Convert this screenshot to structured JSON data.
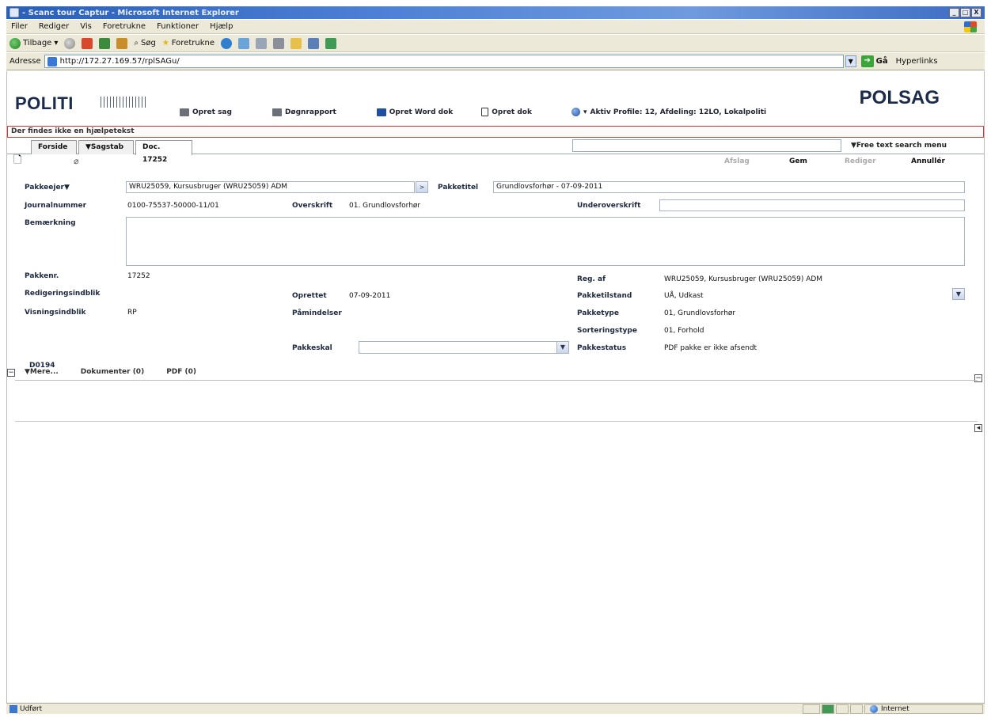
{
  "window": {
    "title": "- Scanc tour Captur - Microsoft Internet Explorer",
    "minimize": "_",
    "maximize": "□",
    "close": "X"
  },
  "menu": [
    "Filer",
    "Rediger",
    "Vis",
    "Foretrukne",
    "Funktioner",
    "Hjælp"
  ],
  "toolbar": {
    "back": "Tilbage",
    "search": "Søg",
    "favorites": "Foretrukne"
  },
  "address": {
    "label": "Adresse",
    "url": "http://172.27.169.57/rplSAGu/",
    "go": "Gå",
    "links": "Hyperlinks"
  },
  "brand": {
    "left": "POLITI",
    "right": "POLSAG"
  },
  "nav": {
    "opret_sag": "Opret sag",
    "dagsrapport": "Døgnrapport",
    "opret_word": "Opret Word dok",
    "opret_dok": "Opret dok",
    "profile": "Aktiv Profile: 12, Afdeling: 12LO, Lokalpoliti"
  },
  "help_text": "Der findes ikke en hjælpetekst",
  "tabs": {
    "forside": "Forside",
    "sagstab": "▼Sagstab",
    "doc": "Doc. 17252",
    "free_text_menu": "▼Free text search menu"
  },
  "actions": {
    "afslag": "Afslag",
    "gem": "Gem",
    "rediger": "Rediger",
    "annuller": "Annullér"
  },
  "form": {
    "pakkeejer_label": "Pakkeejer▼",
    "pakkeejer_value": "WRU25059, Kursusbruger (WRU25059) ADM",
    "pakketitel_label": "Pakketitel",
    "pakketitel_value": "Grundlovsforhør - 07-09-2011",
    "journalnummer_label": "Journalnummer",
    "journalnummer_value": "0100-75537-50000-11/01",
    "overskrift_label": "Overskrift",
    "overskrift_value": "01. Grundlovsforhør",
    "underoverskrift_label": "Underoverskrift",
    "underoverskrift_value": "",
    "bemaerkning_label": "Bemærkning",
    "bemaerkning_value": "",
    "pakkenr_label": "Pakkenr.",
    "pakkenr_value": "17252",
    "regaf_label": "Reg. af",
    "regaf_value": "WRU25059, Kursusbruger (WRU25059) ADM",
    "redigering_label": "Redigeringsindblik",
    "redigering_value": "",
    "oprettet_label": "Oprettet",
    "oprettet_value": "07-09-2011",
    "pakketilstand_label": "Pakketilstand",
    "pakketilstand_value": "UÅ, Udkast",
    "visning_label": "Visningsindblik",
    "visning_value": "RP",
    "paamindelser_label": "Påmindelser",
    "paamindelser_value": "",
    "pakketype_label": "Pakketype",
    "pakketype_value": "01, Grundlovsforhør",
    "sortering_label": "Sorteringstype",
    "sortering_value": "01, Forhold",
    "pakkeskal_label": "Pakkeskal",
    "pakkeskal_value": "",
    "pakkestatus_label": "Pakkestatus",
    "pakkestatus_value": "PDF pakke er ikke afsendt",
    "code": "D0194"
  },
  "bottom_tabs": {
    "mere": "▼Mere...",
    "dokumenter": "Dokumenter (0)",
    "pdf": "PDF (0)"
  },
  "status": {
    "left": "Udført",
    "zone": "Internet"
  }
}
